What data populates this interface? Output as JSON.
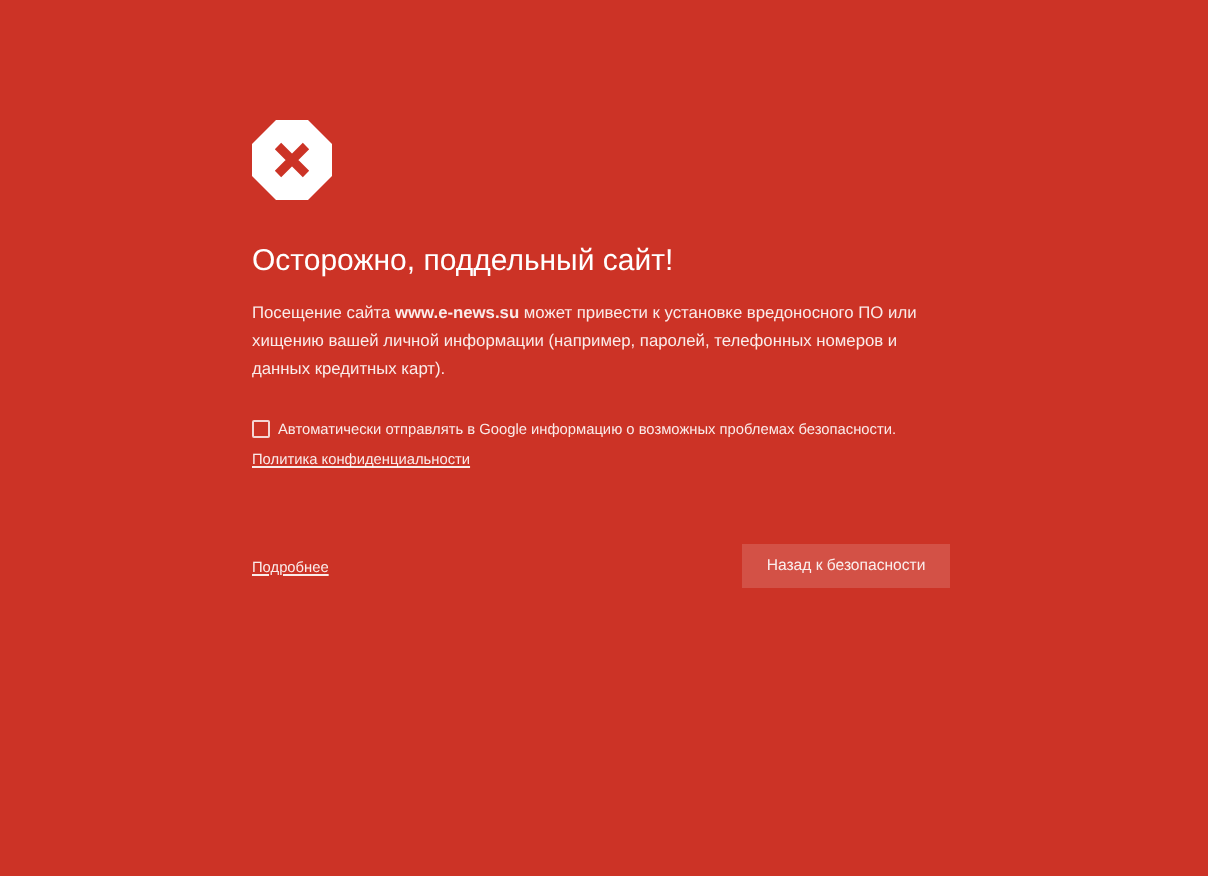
{
  "title": "Осторожно, поддельный сайт!",
  "message": "Посещение сайта **www.e-news.su** может привести к установке вредоносного ПО или хищению вашей личной информации (например, паролей, телефонных номеров и данных кредитных карт).",
  "report_checkbox": {
    "label": "Автоматически отправлять в Google информацию о возможных проблемах безопасности.",
    "checked": false
  },
  "privacy_link": "Политика конфиденциальности",
  "details_link": "Подробнее",
  "back_button": "Назад к безопасности"
}
